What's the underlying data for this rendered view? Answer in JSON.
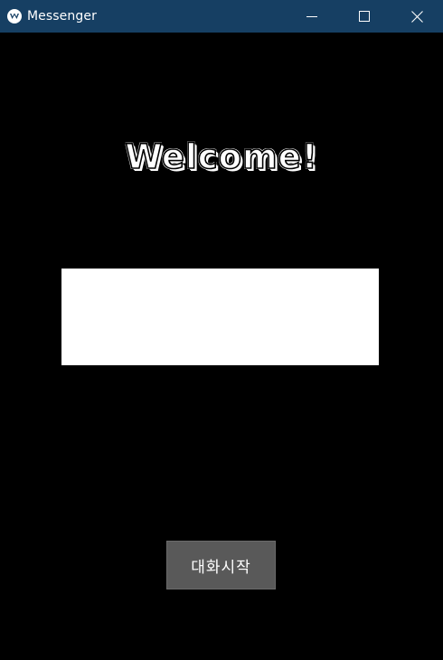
{
  "window": {
    "title": "Messenger",
    "app_icon": "kivy-logo-icon",
    "controls": {
      "minimize_icon": "minimize-icon",
      "maximize_icon": "maximize-icon",
      "close_icon": "close-icon"
    },
    "titlebar_color": "#163f63"
  },
  "main": {
    "heading": "Welcome!",
    "name_input": {
      "value": "",
      "placeholder": ""
    },
    "start_button_label": "대화시작",
    "background_color": "#000000",
    "button_color": "#595959"
  }
}
